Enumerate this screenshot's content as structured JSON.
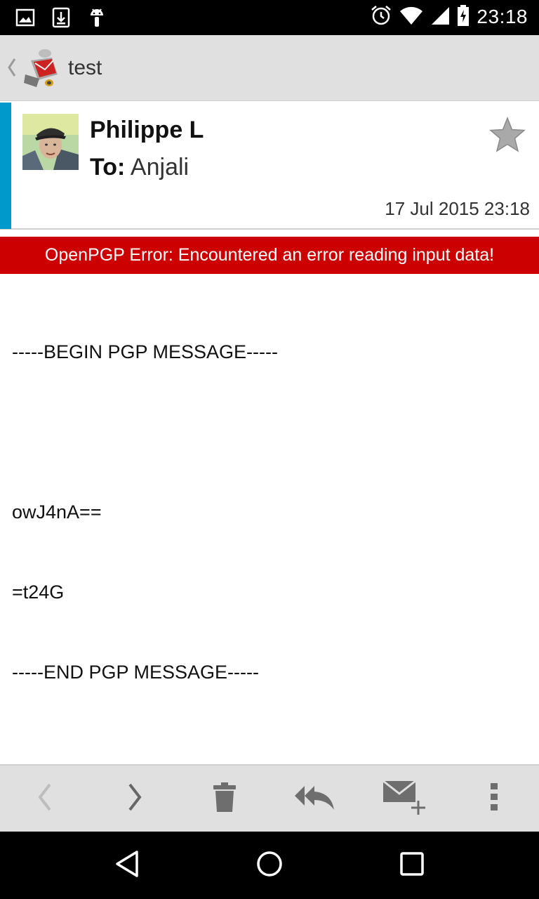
{
  "status_bar": {
    "time": "23:18",
    "left_icons": [
      "image-notification-icon",
      "download-icon",
      "android-debug-icon"
    ],
    "right_icons": [
      "alarm-icon",
      "wifi-icon",
      "cell-signal-icon",
      "battery-charging-icon"
    ]
  },
  "action_bar": {
    "title": "test"
  },
  "message": {
    "sender": "Philippe L",
    "to_label": "To:",
    "recipient": "Anjali",
    "date": "17 Jul 2015 23:18",
    "starred": false,
    "account_color": "#0099cc"
  },
  "error": {
    "text": "OpenPGP Error: Encountered an error reading input data!",
    "color": "#cc0000"
  },
  "body": {
    "lines": [
      "-----BEGIN PGP MESSAGE-----",
      "",
      "owJ4nA==",
      "=t24G",
      "-----END PGP MESSAGE-----"
    ]
  },
  "toolbar": {
    "items": [
      "previous-message",
      "next-message",
      "delete",
      "reply-all",
      "compose",
      "more-options"
    ]
  },
  "nav_bar": {
    "items": [
      "back",
      "home",
      "recent-apps"
    ]
  }
}
